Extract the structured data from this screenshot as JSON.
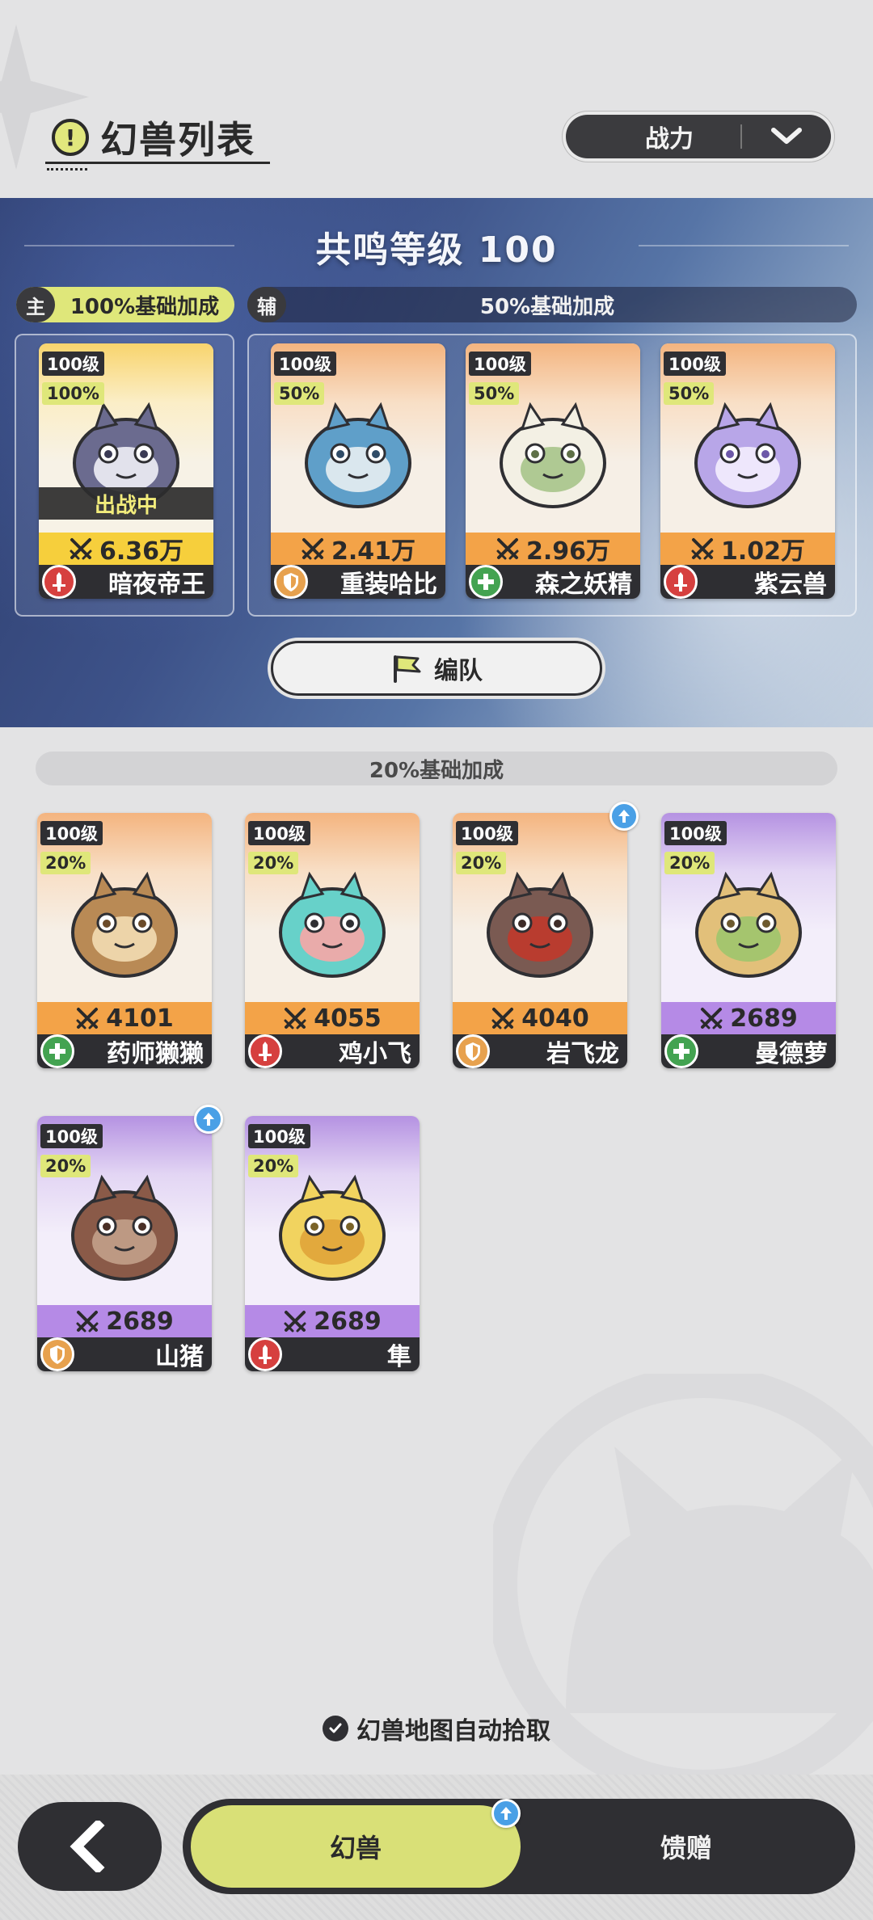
{
  "header": {
    "title": "幻兽列表",
    "info_glyph": "!",
    "sort_label": "战力"
  },
  "resonance": {
    "title": "共鸣等级 100",
    "main_tag": "主",
    "main_bonus": "100%基础加成",
    "aux_tag": "辅",
    "aux_bonus": "50%基础加成",
    "formation_label": "编队"
  },
  "lower": {
    "bonus_label": "20%基础加成"
  },
  "cards": [
    {
      "level": "100级",
      "bonus": "100%",
      "status": "出战中",
      "power": "6.36万",
      "name": "暗夜帝王",
      "role": "attack",
      "rarity": "main"
    },
    {
      "level": "100级",
      "bonus": "50%",
      "power": "2.41万",
      "name": "重装哈比",
      "role": "defense",
      "rarity": "orange"
    },
    {
      "level": "100级",
      "bonus": "50%",
      "power": "2.96万",
      "name": "森之妖精",
      "role": "heal",
      "rarity": "orange"
    },
    {
      "level": "100级",
      "bonus": "50%",
      "power": "1.02万",
      "name": "紫云兽",
      "role": "attack",
      "rarity": "orange"
    },
    {
      "level": "100级",
      "bonus": "20%",
      "power": "4101",
      "name": "药师獭獭",
      "role": "heal",
      "rarity": "orange"
    },
    {
      "level": "100级",
      "bonus": "20%",
      "power": "4055",
      "name": "鸡小飞",
      "role": "attack",
      "rarity": "orange"
    },
    {
      "level": "100级",
      "bonus": "20%",
      "power": "4040",
      "name": "岩飞龙",
      "role": "defense",
      "rarity": "orange",
      "upgrade": true
    },
    {
      "level": "100级",
      "bonus": "20%",
      "power": "2689",
      "name": "曼德萝",
      "role": "heal",
      "rarity": "purple"
    },
    {
      "level": "100级",
      "bonus": "20%",
      "power": "2689",
      "name": "山猪",
      "role": "defense",
      "rarity": "purple",
      "upgrade": true
    },
    {
      "level": "100级",
      "bonus": "20%",
      "power": "2689",
      "name": "隼",
      "role": "attack",
      "rarity": "purple"
    }
  ],
  "auto_pickup": "幻兽地图自动拾取",
  "nav": {
    "tab_active": "幻兽",
    "tab_inactive": "馈赠"
  },
  "colors": {
    "accent": "#dfe77a",
    "dark": "#2f2f33",
    "orange_rarity": "#f3a348",
    "purple_rarity": "#b58ae6",
    "gold_rarity": "#f6cf3c"
  }
}
